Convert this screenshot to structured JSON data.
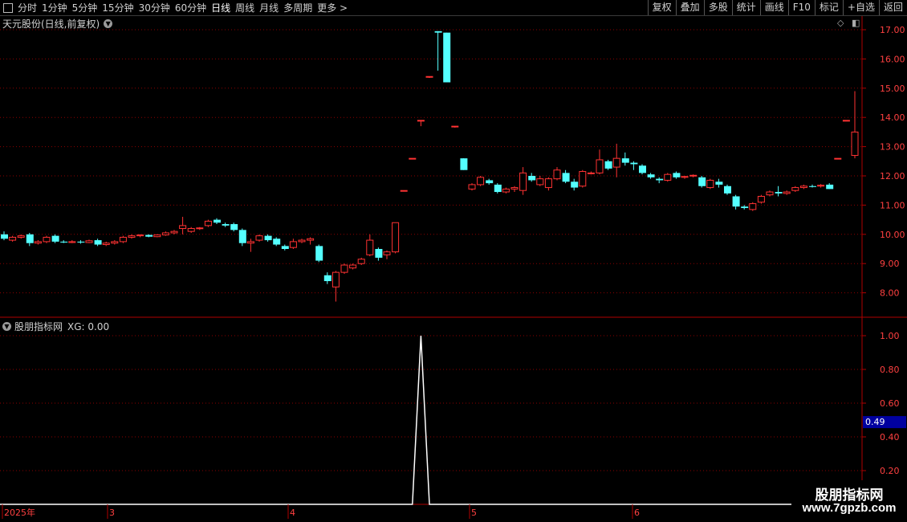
{
  "toolbar": {
    "left_items": [
      "分时",
      "1分钟",
      "5分钟",
      "15分钟",
      "30分钟",
      "60分钟",
      "日线",
      "周线",
      "月线",
      "多周期",
      "更多 >"
    ],
    "active_index": 6,
    "right_items": [
      "复权",
      "叠加",
      "多股",
      "统计",
      "画线",
      "F10",
      "标记",
      "+自选",
      "返回"
    ]
  },
  "main_label": "天元股份(日线,前复权)",
  "indicator_label": "股朋指标网",
  "indicator_value": "XG: 0.00",
  "price_axis": [
    "17.00",
    "16.00",
    "15.00",
    "14.00",
    "13.00",
    "12.00",
    "11.00",
    "10.00",
    "9.00",
    "8.00"
  ],
  "ind_axis": [
    "1.00",
    "0.80",
    "0.60",
    "0.40",
    "0.20"
  ],
  "ind_current": "0.49",
  "date_axis": [
    "2025年",
    "3",
    "4",
    "5",
    "6"
  ],
  "watermark": {
    "line1": "股朋指标网",
    "line2": "www.7gpzb.com"
  },
  "colors": {
    "up": "#ff3232",
    "down": "#54ffff",
    "grid": "#8b0000",
    "axis": "#b00000",
    "bg": "#000000"
  },
  "chart_data": [
    {
      "type": "candlestick",
      "title": "天元股份(日线,前复权)",
      "ylim": [
        7.5,
        17.3
      ],
      "candles": [
        [
          10.0,
          10.1,
          9.8,
          9.85
        ],
        [
          9.8,
          9.95,
          9.75,
          9.9
        ],
        [
          9.9,
          10.0,
          9.85,
          9.95
        ],
        [
          10.0,
          10.05,
          9.6,
          9.7
        ],
        [
          9.7,
          9.8,
          9.65,
          9.75
        ],
        [
          9.75,
          9.95,
          9.7,
          9.9
        ],
        [
          9.95,
          10.0,
          9.7,
          9.75
        ],
        [
          9.75,
          9.8,
          9.7,
          9.72
        ],
        [
          9.72,
          9.8,
          9.7,
          9.75
        ],
        [
          9.75,
          9.8,
          9.68,
          9.72
        ],
        [
          9.72,
          9.82,
          9.7,
          9.78
        ],
        [
          9.8,
          9.85,
          9.6,
          9.65
        ],
        [
          9.65,
          9.75,
          9.6,
          9.7
        ],
        [
          9.7,
          9.8,
          9.65,
          9.75
        ],
        [
          9.75,
          9.95,
          9.7,
          9.9
        ],
        [
          9.9,
          10.0,
          9.85,
          9.95
        ],
        [
          9.95,
          10.0,
          9.9,
          9.98
        ],
        [
          9.98,
          10.0,
          9.9,
          9.92
        ],
        [
          9.92,
          10.0,
          9.9,
          9.98
        ],
        [
          9.98,
          10.1,
          9.95,
          10.05
        ],
        [
          10.05,
          10.15,
          10.0,
          10.1
        ],
        [
          10.2,
          10.6,
          10.0,
          10.3
        ],
        [
          10.1,
          10.25,
          10.05,
          10.2
        ],
        [
          10.2,
          10.25,
          10.15,
          10.22
        ],
        [
          10.3,
          10.5,
          10.25,
          10.45
        ],
        [
          10.5,
          10.55,
          10.35,
          10.4
        ],
        [
          10.35,
          10.4,
          10.25,
          10.3
        ],
        [
          10.35,
          10.4,
          10.1,
          10.15
        ],
        [
          10.15,
          10.2,
          9.6,
          9.7
        ],
        [
          9.7,
          9.85,
          9.4,
          9.75
        ],
        [
          9.8,
          10.0,
          9.75,
          9.95
        ],
        [
          9.95,
          10.0,
          9.75,
          9.8
        ],
        [
          9.85,
          9.9,
          9.6,
          9.65
        ],
        [
          9.6,
          9.65,
          9.45,
          9.5
        ],
        [
          9.55,
          9.85,
          9.5,
          9.75
        ],
        [
          9.75,
          9.85,
          9.7,
          9.8
        ],
        [
          9.8,
          9.9,
          9.65,
          9.85
        ],
        [
          9.6,
          9.65,
          9.05,
          9.1
        ],
        [
          8.6,
          8.7,
          8.3,
          8.4
        ],
        [
          8.2,
          8.75,
          7.7,
          8.7
        ],
        [
          8.7,
          9.0,
          8.65,
          8.95
        ],
        [
          8.85,
          9.0,
          8.8,
          8.95
        ],
        [
          9.0,
          9.2,
          8.95,
          9.15
        ],
        [
          9.3,
          10.0,
          9.25,
          9.8
        ],
        [
          9.5,
          9.55,
          9.1,
          9.2
        ],
        [
          9.3,
          9.45,
          9.15,
          9.4
        ],
        [
          9.4,
          10.4,
          9.35,
          10.4
        ],
        [
          11.5,
          11.5,
          11.5,
          11.5
        ],
        [
          12.6,
          12.6,
          12.6,
          12.6
        ],
        [
          13.9,
          13.9,
          13.7,
          13.9
        ],
        [
          15.4,
          15.4,
          15.35,
          15.4
        ],
        [
          16.95,
          16.95,
          15.6,
          16.9
        ],
        [
          16.9,
          16.9,
          15.2,
          15.2
        ],
        [
          13.7,
          13.7,
          13.65,
          13.7
        ],
        [
          12.6,
          12.6,
          12.2,
          12.2
        ],
        [
          11.55,
          11.75,
          11.5,
          11.7
        ],
        [
          11.7,
          12.0,
          11.65,
          11.95
        ],
        [
          11.85,
          11.9,
          11.7,
          11.75
        ],
        [
          11.7,
          11.75,
          11.4,
          11.45
        ],
        [
          11.45,
          11.6,
          11.4,
          11.55
        ],
        [
          11.55,
          11.65,
          11.45,
          11.6
        ],
        [
          11.5,
          12.3,
          11.35,
          12.1
        ],
        [
          12.0,
          12.1,
          11.8,
          11.85
        ],
        [
          11.7,
          12.0,
          11.65,
          11.9
        ],
        [
          11.6,
          11.95,
          11.5,
          11.9
        ],
        [
          11.9,
          12.3,
          11.85,
          12.2
        ],
        [
          12.1,
          12.2,
          11.75,
          11.8
        ],
        [
          11.8,
          11.9,
          11.5,
          11.6
        ],
        [
          11.65,
          12.2,
          11.6,
          12.15
        ],
        [
          12.1,
          12.15,
          12.05,
          12.1
        ],
        [
          12.1,
          12.9,
          12.05,
          12.55
        ],
        [
          12.5,
          12.55,
          12.2,
          12.25
        ],
        [
          12.3,
          13.1,
          11.95,
          12.6
        ],
        [
          12.6,
          12.8,
          12.35,
          12.45
        ],
        [
          12.45,
          12.5,
          12.2,
          12.4
        ],
        [
          12.35,
          12.4,
          12.05,
          12.1
        ],
        [
          12.05,
          12.1,
          11.9,
          11.95
        ],
        [
          11.9,
          11.95,
          11.75,
          11.85
        ],
        [
          11.85,
          12.1,
          11.8,
          12.05
        ],
        [
          12.1,
          12.15,
          11.9,
          11.95
        ],
        [
          11.95,
          12.0,
          11.9,
          11.98
        ],
        [
          12.0,
          12.05,
          11.95,
          12.02
        ],
        [
          11.95,
          12.0,
          11.6,
          11.65
        ],
        [
          11.6,
          11.9,
          11.55,
          11.85
        ],
        [
          11.8,
          11.9,
          11.6,
          11.7
        ],
        [
          11.65,
          11.7,
          11.35,
          11.4
        ],
        [
          11.3,
          11.35,
          10.85,
          10.95
        ],
        [
          10.95,
          11.0,
          10.85,
          10.9
        ],
        [
          10.85,
          11.1,
          10.8,
          11.05
        ],
        [
          11.1,
          11.35,
          11.05,
          11.3
        ],
        [
          11.35,
          11.5,
          11.3,
          11.45
        ],
        [
          11.45,
          11.65,
          11.3,
          11.4
        ],
        [
          11.4,
          11.5,
          11.35,
          11.45
        ],
        [
          11.5,
          11.65,
          11.45,
          11.6
        ],
        [
          11.6,
          11.7,
          11.55,
          11.65
        ],
        [
          11.65,
          11.7,
          11.6,
          11.62
        ],
        [
          11.65,
          11.72,
          11.6,
          11.68
        ],
        [
          11.7,
          11.75,
          11.55,
          11.55
        ],
        [
          12.6,
          12.6,
          12.6,
          12.6
        ],
        [
          13.9,
          13.9,
          13.9,
          13.9
        ],
        [
          12.7,
          14.9,
          12.6,
          13.5
        ]
      ]
    },
    {
      "type": "line",
      "title": "股朋指标网 XG",
      "ylim": [
        0,
        1.05
      ],
      "values": [
        0,
        0,
        0,
        0,
        0,
        0,
        0,
        0,
        0,
        0,
        0,
        0,
        0,
        0,
        0,
        0,
        0,
        0,
        0,
        0,
        0,
        0,
        0,
        0,
        0,
        0,
        0,
        0,
        0,
        0,
        0,
        0,
        0,
        0,
        0,
        0,
        0,
        0,
        0,
        0,
        0,
        0,
        0,
        0,
        0,
        0,
        0,
        0,
        0,
        1,
        0,
        0,
        0,
        0,
        0,
        0,
        0,
        0,
        0,
        0,
        0,
        0,
        0,
        0,
        0,
        0,
        0,
        0,
        0,
        0,
        0,
        0,
        0,
        0,
        0,
        0,
        0,
        0,
        0,
        0,
        0,
        0,
        0,
        0,
        0,
        0,
        0,
        0,
        0,
        0,
        0,
        0,
        0,
        0,
        0,
        0,
        0,
        0,
        0,
        0,
        0
      ]
    }
  ]
}
